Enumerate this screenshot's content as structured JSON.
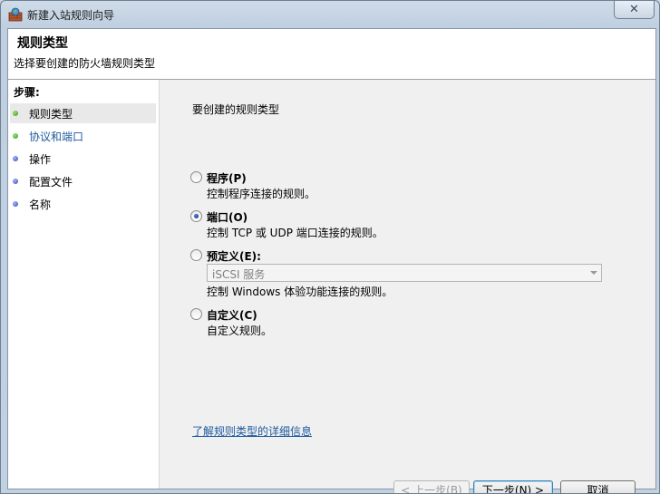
{
  "window": {
    "title": "新建入站规则向导",
    "close_label": "✕"
  },
  "header": {
    "title": "规则类型",
    "subtitle": "选择要创建的防火墙规则类型"
  },
  "sidebar": {
    "steps_title": "步骤:",
    "steps": [
      {
        "label": "规则类型",
        "status": "done",
        "current": true
      },
      {
        "label": "协议和端口",
        "status": "done",
        "current": false
      },
      {
        "label": "操作",
        "status": "pending",
        "current": false
      },
      {
        "label": "配置文件",
        "status": "pending",
        "current": false
      },
      {
        "label": "名称",
        "status": "pending",
        "current": false
      }
    ]
  },
  "main": {
    "prompt": "要创建的规则类型",
    "options": [
      {
        "label": "程序(P)",
        "desc": "控制程序连接的规则。",
        "checked": false
      },
      {
        "label": "端口(O)",
        "desc": "控制 TCP 或 UDP 端口连接的规则。",
        "checked": true
      },
      {
        "label": "预定义(E):",
        "desc": "控制 Windows 体验功能连接的规则。",
        "checked": false
      },
      {
        "label": "自定义(C)",
        "desc": "自定义规则。",
        "checked": false
      }
    ],
    "predefined_select": "iSCSI 服务",
    "learn_link": "了解规则类型的详细信息"
  },
  "buttons": {
    "back": "< 上一步(B)",
    "next": "下一步(N) >",
    "cancel": "取消"
  },
  "colors": {
    "link": "#1e5a9e",
    "done_dot": "#2f9a1f",
    "pending_dot": "#3443b0"
  }
}
